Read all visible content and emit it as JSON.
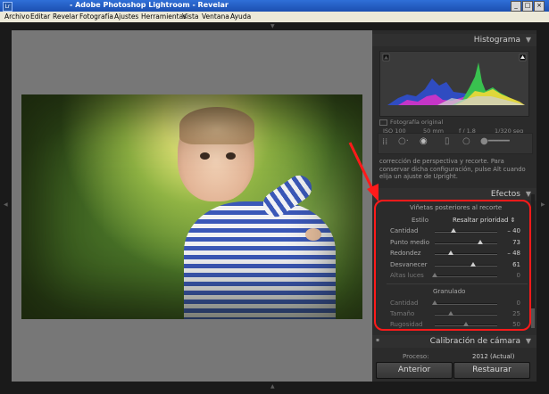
{
  "window": {
    "title": "- Adobe Photoshop Lightroom - Revelar",
    "app_icon": "Lr",
    "controls": [
      "_",
      "□",
      "×"
    ]
  },
  "menu": [
    "Archivo",
    "Editar",
    "Revelar",
    "Fotografía",
    "Ajustes",
    "Herramientas",
    "Vista",
    "Ventana",
    "Ayuda"
  ],
  "histogram": {
    "title": "Histograma",
    "iso": "ISO 100",
    "focal": "50 mm",
    "aperture": "f / 1,8",
    "shutter": "1/320 seg",
    "original_label": "Fotografía original"
  },
  "tools": [
    "crop-grid-icon",
    "spot-removal-icon",
    "red-eye-icon",
    "graduated-filter-icon",
    "radial-filter-icon",
    "adjustment-brush-icon"
  ],
  "lens_description": "corrección de perspectiva y recorte. Para conservar dicha configuración, pulse Alt cuando elija un ajuste de Upright.",
  "effects": {
    "title": "Efectos",
    "vignette_title": "Viñetas posteriores al recorte",
    "style_label": "Estilo",
    "style_value": "Resaltar prioridad ⇕",
    "vignette": [
      {
        "label": "Cantidad",
        "value": "– 40",
        "pos": 0.3,
        "dim": false
      },
      {
        "label": "Punto medio",
        "value": "73",
        "pos": 0.73,
        "dim": false
      },
      {
        "label": "Redondez",
        "value": "– 48",
        "pos": 0.26,
        "dim": false
      },
      {
        "label": "Desvanecer",
        "value": "61",
        "pos": 0.61,
        "dim": false
      },
      {
        "label": "Altas luces",
        "value": "0",
        "pos": 0.0,
        "dim": true
      }
    ],
    "grain_title": "Granulado",
    "grain": [
      {
        "label": "Cantidad",
        "value": "0",
        "pos": 0.0
      },
      {
        "label": "Tamaño",
        "value": "25",
        "pos": 0.25
      },
      {
        "label": "Rugosidad",
        "value": "50",
        "pos": 0.5
      }
    ]
  },
  "camera_calibration": {
    "title": "Calibración de cámara",
    "process_label": "Proceso:",
    "process_value": "2012 (Actual)"
  },
  "buttons": {
    "previous": "Anterior",
    "reset": "Restaurar"
  },
  "colors": {
    "annotation": "#ff1a1a",
    "titlebar": "#2f6fd8",
    "canvas": "#777777",
    "panel": "#2b2b2b"
  }
}
